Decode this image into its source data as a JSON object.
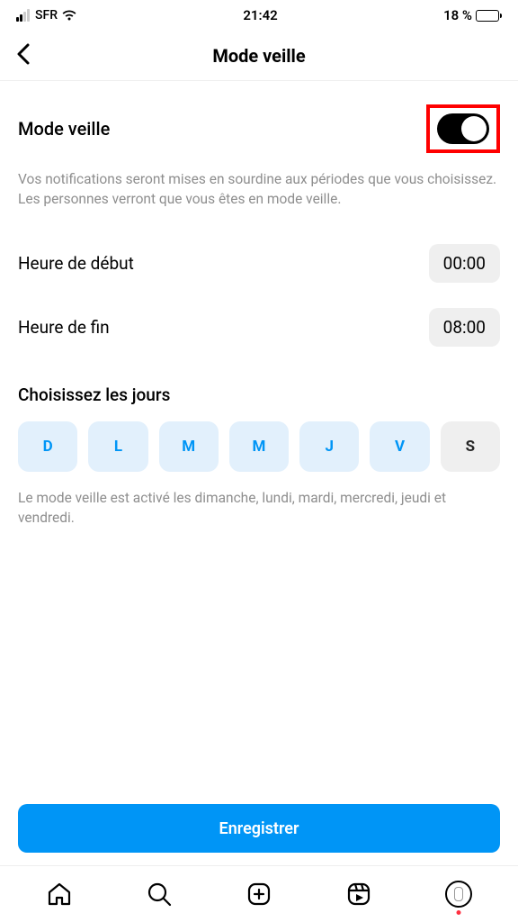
{
  "status": {
    "carrier": "SFR",
    "time": "21:42",
    "battery_pct": "18 %"
  },
  "header": {
    "title": "Mode veille"
  },
  "toggle": {
    "label": "Mode veille",
    "on": true
  },
  "description": "Vos notifications seront mises en sourdine aux périodes que vous choisissez. Les personnes verront que vous êtes en mode veille.",
  "start": {
    "label": "Heure de début",
    "value": "00:00"
  },
  "end": {
    "label": "Heure de fin",
    "value": "08:00"
  },
  "days_section": {
    "title": "Choisissez les jours",
    "items": [
      {
        "label": "D",
        "active": true
      },
      {
        "label": "L",
        "active": true
      },
      {
        "label": "M",
        "active": true
      },
      {
        "label": "M",
        "active": true
      },
      {
        "label": "J",
        "active": true
      },
      {
        "label": "V",
        "active": true
      },
      {
        "label": "S",
        "active": false
      }
    ],
    "note": "Le mode veille est activé les dimanche, lundi, mardi, mercredi, jeudi et vendredi."
  },
  "save_label": "Enregistrer"
}
